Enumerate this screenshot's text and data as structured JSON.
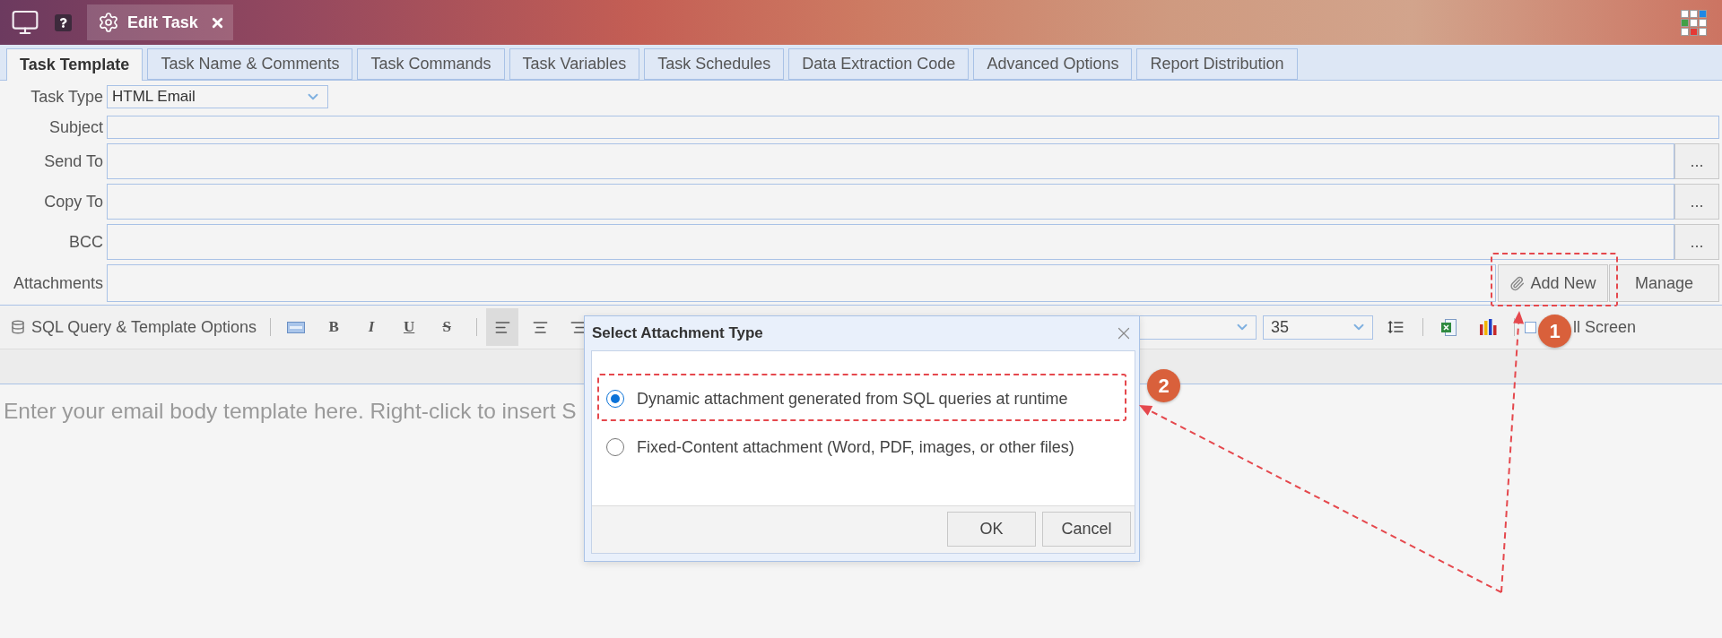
{
  "title_bar": {
    "tab_label": "Edit Task"
  },
  "tabs": [
    {
      "label": "Task Template",
      "selected": true
    },
    {
      "label": "Task Name & Comments",
      "selected": false
    },
    {
      "label": "Task Commands",
      "selected": false
    },
    {
      "label": "Task Variables",
      "selected": false
    },
    {
      "label": "Task Schedules",
      "selected": false
    },
    {
      "label": "Data Extraction Code",
      "selected": false
    },
    {
      "label": "Advanced Options",
      "selected": false
    },
    {
      "label": "Report Distribution",
      "selected": false
    }
  ],
  "form": {
    "task_type": {
      "label": "Task Type",
      "value": "HTML Email"
    },
    "fields": [
      {
        "label": "Subject",
        "kind": "text"
      },
      {
        "label": "Send To",
        "kind": "picker",
        "button": "..."
      },
      {
        "label": "Copy To",
        "kind": "picker",
        "button": "..."
      },
      {
        "label": "BCC",
        "kind": "picker",
        "button": "..."
      },
      {
        "label": "Attachments",
        "kind": "attachments",
        "buttons": [
          "Add New",
          "Manage"
        ]
      }
    ]
  },
  "toolbar": {
    "items": [
      {
        "kind": "menu",
        "label": "SQL Query & Template Options"
      },
      {
        "kind": "separator"
      },
      {
        "kind": "html"
      },
      {
        "kind": "bold",
        "label": "B"
      },
      {
        "kind": "italic",
        "label": "I"
      },
      {
        "kind": "underline",
        "label": "U"
      },
      {
        "kind": "strike",
        "label": "S"
      },
      {
        "kind": "separator"
      },
      {
        "kind": "alignleft",
        "selected": true
      },
      {
        "kind": "aligncenter",
        "selected": false
      },
      {
        "kind": "alignright",
        "selected": false
      }
    ],
    "right_items": [
      {
        "kind": "select"
      },
      {
        "kind": "select",
        "value": "35"
      },
      {
        "kind": "linespacing"
      },
      {
        "kind": "separator"
      },
      {
        "kind": "excel"
      },
      {
        "kind": "chart"
      },
      {
        "kind": "separator"
      },
      {
        "kind": "toggle",
        "label": "ll Screen",
        "checked": false
      }
    ]
  },
  "editor": {
    "placeholder": "Enter your email body template here. Right-click to insert S"
  },
  "dialog": {
    "title": "Select Attachment Type",
    "options": [
      {
        "label": "Dynamic attachment generated from SQL queries at runtime",
        "selected": true
      },
      {
        "label": "Fixed-Content attachment (Word, PDF, images, or other files)",
        "selected": false
      }
    ],
    "buttons": [
      "OK",
      "Cancel"
    ]
  },
  "annotations": {
    "markers": [
      "1",
      "2"
    ]
  }
}
